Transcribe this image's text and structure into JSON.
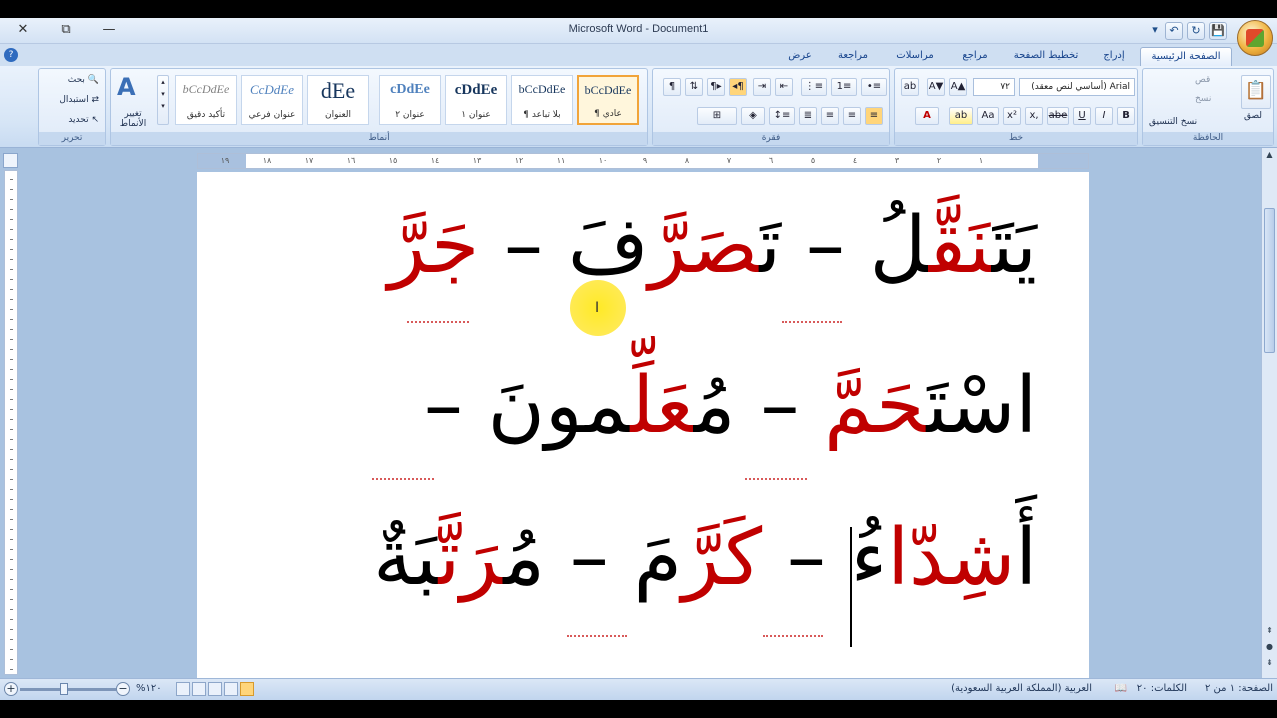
{
  "window": {
    "title": "Microsoft Word - Document1",
    "close_glyph": "✕",
    "restore_glyph": "⧉",
    "minimize_glyph": "—"
  },
  "quick_access": {
    "save": "💾",
    "undo": "↶",
    "redo": "↻",
    "more": "▾"
  },
  "help": "?",
  "tabs": [
    "الصفحة الرئيسية",
    "إدراج",
    "تخطيط الصفحة",
    "مراجع",
    "مراسلات",
    "مراجعة",
    "عرض"
  ],
  "ribbon": {
    "clipboard": {
      "label": "الحافظة",
      "paste": "لصق",
      "cut": "قص",
      "copy": "نسخ",
      "format_painter": "نسخ التنسيق"
    },
    "font": {
      "label": "خط",
      "font_name": "Arial (أساسي لنص معقد)",
      "font_size": "٧٢",
      "bold": "B",
      "italic": "I",
      "underline": "U",
      "strike": "abe",
      "subscript": "x,",
      "superscript": "x²",
      "case": "Aa",
      "grow": "A▲",
      "shrink": "A▼",
      "clear": "ab"
    },
    "paragraph": {
      "label": "فقرة",
      "show_marks": "¶"
    },
    "styles": {
      "label": "أنماط",
      "items": [
        {
          "sample": "bCcDdEe",
          "name": "¶ عادي"
        },
        {
          "sample": "bCcDdEe",
          "name": "¶ بلا تباعد"
        },
        {
          "sample": "cDdEe",
          "name": "عنوان ١"
        },
        {
          "sample": "cDdEe",
          "name": "عنوان ٢"
        },
        {
          "sample": "dEe",
          "name": "العنوان"
        },
        {
          "sample": "CcDdEe",
          "name": "عنوان فرعي"
        },
        {
          "sample": "bCcDdEe",
          "name": "تأكيد دقيق"
        }
      ],
      "change_styles": "تغيير الأنماط"
    },
    "editing": {
      "label": "تحرير",
      "find": "بحث",
      "replace": "استبدال",
      "select": "تحديد"
    }
  },
  "ruler": {
    "ticks": [
      "١٩",
      "١٨",
      "١٧",
      "١٦",
      "١٥",
      "١٤",
      "١٣",
      "١٢",
      "١١",
      "١٠",
      "٩",
      "٨",
      "٧",
      "٦",
      "٥",
      "٤",
      "٣",
      "٢",
      "١"
    ]
  },
  "document": {
    "lines": [
      [
        {
          "t": "يَتَ",
          "c": "black"
        },
        {
          "t": "نَقَّ",
          "c": "red"
        },
        {
          "t": "لُ",
          "c": "black"
        },
        {
          "t": " – ",
          "c": "black"
        },
        {
          "t": "تَ",
          "c": "black"
        },
        {
          "t": "صَرَّ",
          "c": "red"
        },
        {
          "t": "فَ",
          "c": "black"
        },
        {
          "t": " – ",
          "c": "black"
        },
        {
          "t": "جَرَّ",
          "c": "red"
        }
      ],
      [
        {
          "t": "اسْتَ",
          "c": "black"
        },
        {
          "t": "حَمَّ",
          "c": "red"
        },
        {
          "t": " – ",
          "c": "black"
        },
        {
          "t": "مُ",
          "c": "black"
        },
        {
          "t": "عَلِّ",
          "c": "red"
        },
        {
          "t": "مونَ",
          "c": "black"
        },
        {
          "t": " –",
          "c": "black"
        }
      ],
      [
        {
          "t": "أَ",
          "c": "black"
        },
        {
          "t": "شِدّا",
          "c": "red"
        },
        {
          "t": "ءُ",
          "c": "black"
        },
        {
          "t": " – ",
          "c": "black"
        },
        {
          "t": "كَرَّ",
          "c": "red"
        },
        {
          "t": "مَ",
          "c": "black"
        },
        {
          "t": " – ",
          "c": "black"
        },
        {
          "t": "مُ",
          "c": "black"
        },
        {
          "t": "رَتَّ",
          "c": "red"
        },
        {
          "t": "بَةٌ",
          "c": "black"
        }
      ]
    ]
  },
  "statusbar": {
    "page": "الصفحة: ١ من ٢",
    "words": "الكلمات: ٢٠",
    "language": "العربية (المملكة العربية السعودية)",
    "zoom": "١٢٠%"
  },
  "colors": {
    "red_text": "#c00000",
    "black_text": "#000000",
    "cursor_highlight": "#ffe600"
  }
}
